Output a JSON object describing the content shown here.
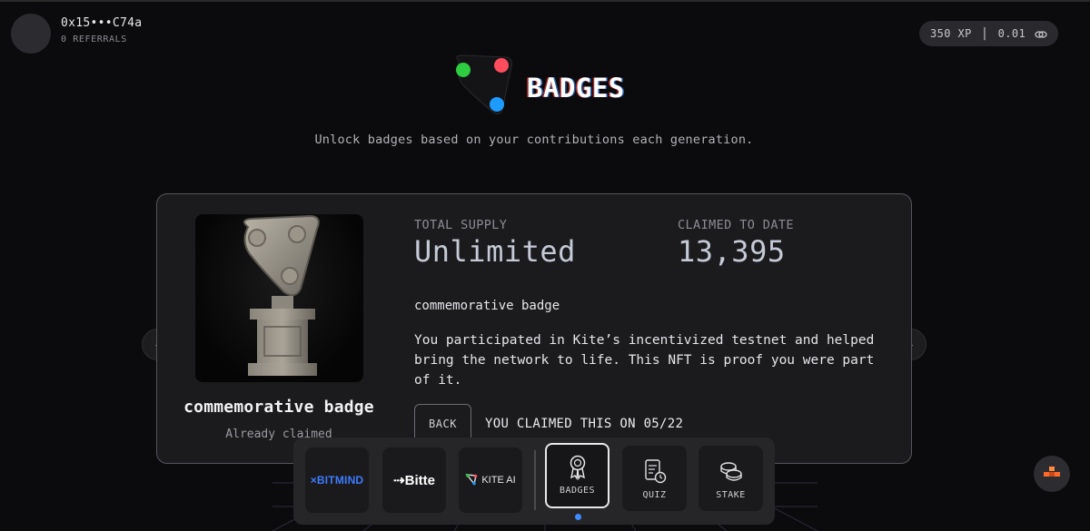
{
  "header": {
    "wallet_address": "0x15•••C74a",
    "referrals": "0 REFERRALS",
    "xp": "350 XP",
    "balance": "0.01",
    "balance_icon": "coins-icon"
  },
  "hero": {
    "title": "BADGES",
    "subtitle": "Unlock badges based on your contributions each generation."
  },
  "badge_card": {
    "name": "commemorative badge",
    "status": "Already claimed",
    "total_supply_label": "TOTAL SUPPLY",
    "total_supply_value": "Unlimited",
    "claimed_label": "CLAIMED TO DATE",
    "claimed_value": "13,395",
    "description_title": "commemorative badge",
    "description": "You participated in Kite’s incentivized testnet and helped bring the network to life. This NFT is proof you were part of it.",
    "back_label": "BACK",
    "claimed_on": "YOU CLAIMED THIS ON 05/22"
  },
  "carousel": {
    "prev_icon": "‹",
    "next_icon": "›"
  },
  "dock": {
    "partners": [
      {
        "name": "BITMIND",
        "prefix": "×"
      },
      {
        "name": "Bitte",
        "prefix": "⇢"
      },
      {
        "name": "KITE AI",
        "prefix": ""
      }
    ],
    "nav": [
      {
        "label": "BADGES",
        "icon": "badge-ribbon-icon",
        "active": true
      },
      {
        "label": "QUIZ",
        "icon": "quiz-clipboard-icon",
        "active": false
      },
      {
        "label": "STAKE",
        "icon": "stake-coins-icon",
        "active": false
      }
    ]
  },
  "colors": {
    "background": "#0b0b0d",
    "card": "#1b1b1e",
    "accent_blue": "#3d8bff",
    "logo_green": "#2ecc40",
    "logo_red": "#ff4d5e",
    "logo_blue": "#1e9bff"
  }
}
